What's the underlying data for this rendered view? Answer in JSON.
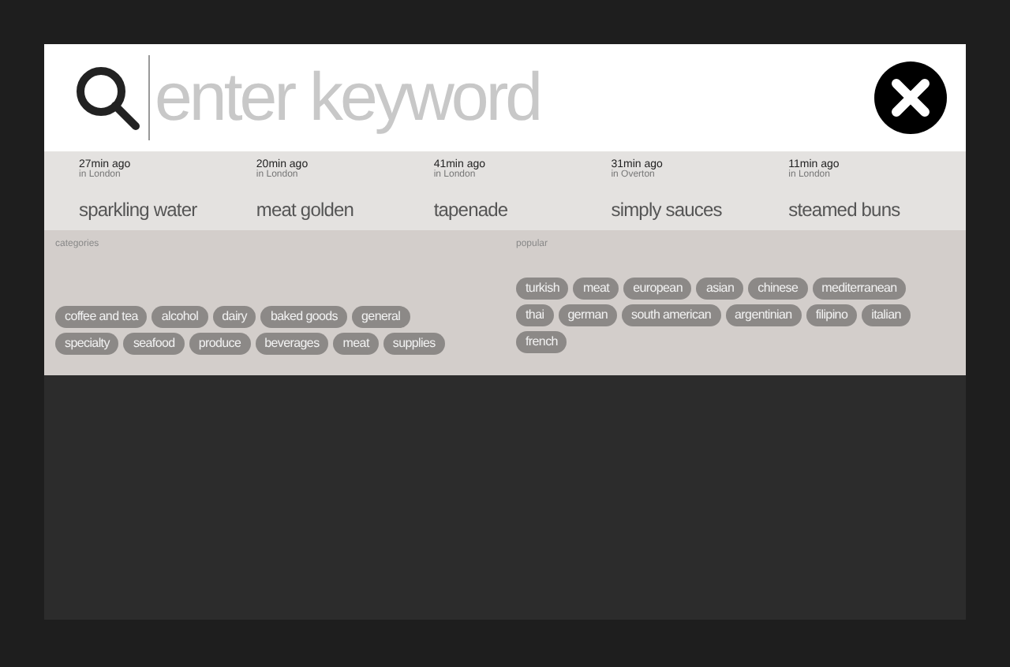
{
  "search": {
    "placeholder": "enter keyword"
  },
  "recent": [
    {
      "time": "27min ago",
      "place": "in London",
      "term": "sparkling water"
    },
    {
      "time": "20min ago",
      "place": "in London",
      "term": "meat golden"
    },
    {
      "time": "41min ago",
      "place": "in London",
      "term": "tapenade"
    },
    {
      "time": "31min ago",
      "place": "in Overton",
      "term": "simply sauces"
    },
    {
      "time": "11min ago",
      "place": "in London",
      "term": "steamed buns"
    }
  ],
  "categories": {
    "title": "categories",
    "tags": [
      "coffee and tea",
      "alcohol",
      "dairy",
      "baked goods",
      "general",
      "specialty",
      "seafood",
      "produce",
      "beverages",
      "meat",
      "supplies"
    ]
  },
  "popular": {
    "title": "popular",
    "tags": [
      "turkish",
      "meat",
      "european",
      "asian",
      "chinese",
      "mediterranean",
      "thai",
      "german",
      "south american",
      "argentinian",
      "filipino",
      "italian",
      "french"
    ]
  }
}
